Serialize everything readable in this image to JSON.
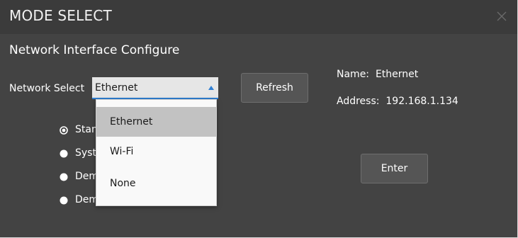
{
  "window": {
    "title": "MODE SELECT"
  },
  "header": "Network Interface Configure",
  "network_select": {
    "label": "Network Select",
    "value": "Ethernet",
    "options": [
      "Ethernet",
      "Wi-Fi",
      "None"
    ],
    "selected_index": 0
  },
  "refresh_label": "Refresh",
  "info": {
    "name_label": "Name:",
    "name_value": "Ethernet",
    "address_label": "Address:",
    "address_value": "192.168.1.134"
  },
  "enter_label": "Enter",
  "modes": [
    {
      "label": "Stan",
      "selected": true
    },
    {
      "label": "Syst",
      "selected": false
    },
    {
      "label": "Dem",
      "selected": false
    },
    {
      "label": "Dem",
      "selected": false
    }
  ],
  "colors": {
    "background": "#434343",
    "titlebar": "#3b3b3b",
    "accent": "#2f7fd3",
    "dropdown_selected": "#c2c2c2"
  }
}
